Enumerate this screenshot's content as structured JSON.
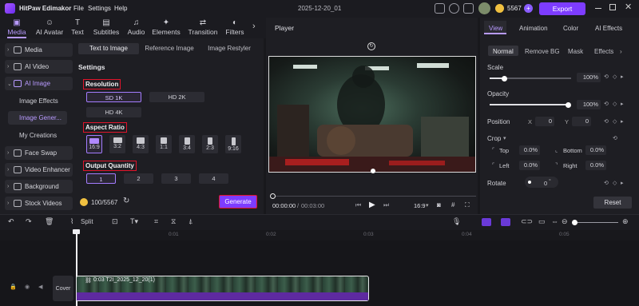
{
  "app": {
    "title": "HitPaw Edimakor",
    "menu": [
      "File",
      "Settings",
      "Help"
    ],
    "project_name": "2025-12-20_01",
    "credits": "5567",
    "export_label": "Export"
  },
  "tabs": [
    {
      "label": "Media",
      "icon": "media-icon"
    },
    {
      "label": "AI Avatar",
      "icon": "ai-avatar-icon"
    },
    {
      "label": "Text",
      "icon": "text-icon"
    },
    {
      "label": "Subtitles",
      "icon": "subtitles-icon"
    },
    {
      "label": "Audio",
      "icon": "audio-icon"
    },
    {
      "label": "Elements",
      "icon": "elements-icon"
    },
    {
      "label": "Transition",
      "icon": "transition-icon"
    },
    {
      "label": "Filters",
      "icon": "filters-icon"
    }
  ],
  "sidebar": {
    "items": [
      {
        "label": "Media"
      },
      {
        "label": "AI Video"
      },
      {
        "label": "AI Image"
      }
    ],
    "sub_items": [
      "Image Effects",
      "Image Gener...",
      "My Creations"
    ],
    "items2": [
      {
        "label": "Face Swap"
      },
      {
        "label": "Video Enhancer"
      },
      {
        "label": "Background"
      },
      {
        "label": "Stock Videos"
      }
    ]
  },
  "panel": {
    "subtabs": [
      "Text to Image",
      "Reference Image",
      "Image Restyler"
    ],
    "settings_title": "Settings",
    "resolution_title": "Resolution",
    "resolutions": [
      "SD 1K",
      "HD 2K",
      "HD 4K"
    ],
    "aspect_title": "Aspect Ratio",
    "ratios": [
      "16:9",
      "3:2",
      "4:3",
      "1:1",
      "3:4",
      "2:3",
      "9:16"
    ],
    "quantity_title": "Output Quantity",
    "quantities": [
      "1",
      "2",
      "3",
      "4"
    ],
    "credit_usage": "100/5567",
    "generate_label": "Generate"
  },
  "player": {
    "title": "Player",
    "time_current": "00:00:00",
    "time_total": "00:03:00",
    "separator": "/",
    "ratio": "16:9"
  },
  "right": {
    "tabs": [
      "View",
      "Animation",
      "Color",
      "AI Effects"
    ],
    "subtabs": [
      "Normal",
      "Remove BG",
      "Mask",
      "Effects"
    ],
    "scale_label": "Scale",
    "scale_value": "100%",
    "scale_level": 1.0,
    "opacity_label": "Opacity",
    "opacity_value": "100%",
    "opacity_level": 1.0,
    "position_label": "Position",
    "pos_x_label": "X",
    "pos_x": "0",
    "pos_y_label": "Y",
    "pos_y": "0",
    "crop_label": "Crop",
    "crop_top_label": "Top",
    "crop_top": "0.0%",
    "crop_bottom_label": "Bottom",
    "crop_bottom": "0.0%",
    "crop_left_label": "Left",
    "crop_left": "0.0%",
    "crop_right_label": "Right",
    "crop_right": "0.0%",
    "rotate_label": "Rotate",
    "rotate_value": "0",
    "rotate_unit": "°",
    "reset_label": "Reset"
  },
  "timeline": {
    "split_label": "Split",
    "ruler": [
      "0:01",
      "0:02",
      "0:03",
      "0:04",
      "0:05"
    ],
    "cover_label": "Cover",
    "clip_label": "0:03  T2I_2025_12_20(1)"
  }
}
